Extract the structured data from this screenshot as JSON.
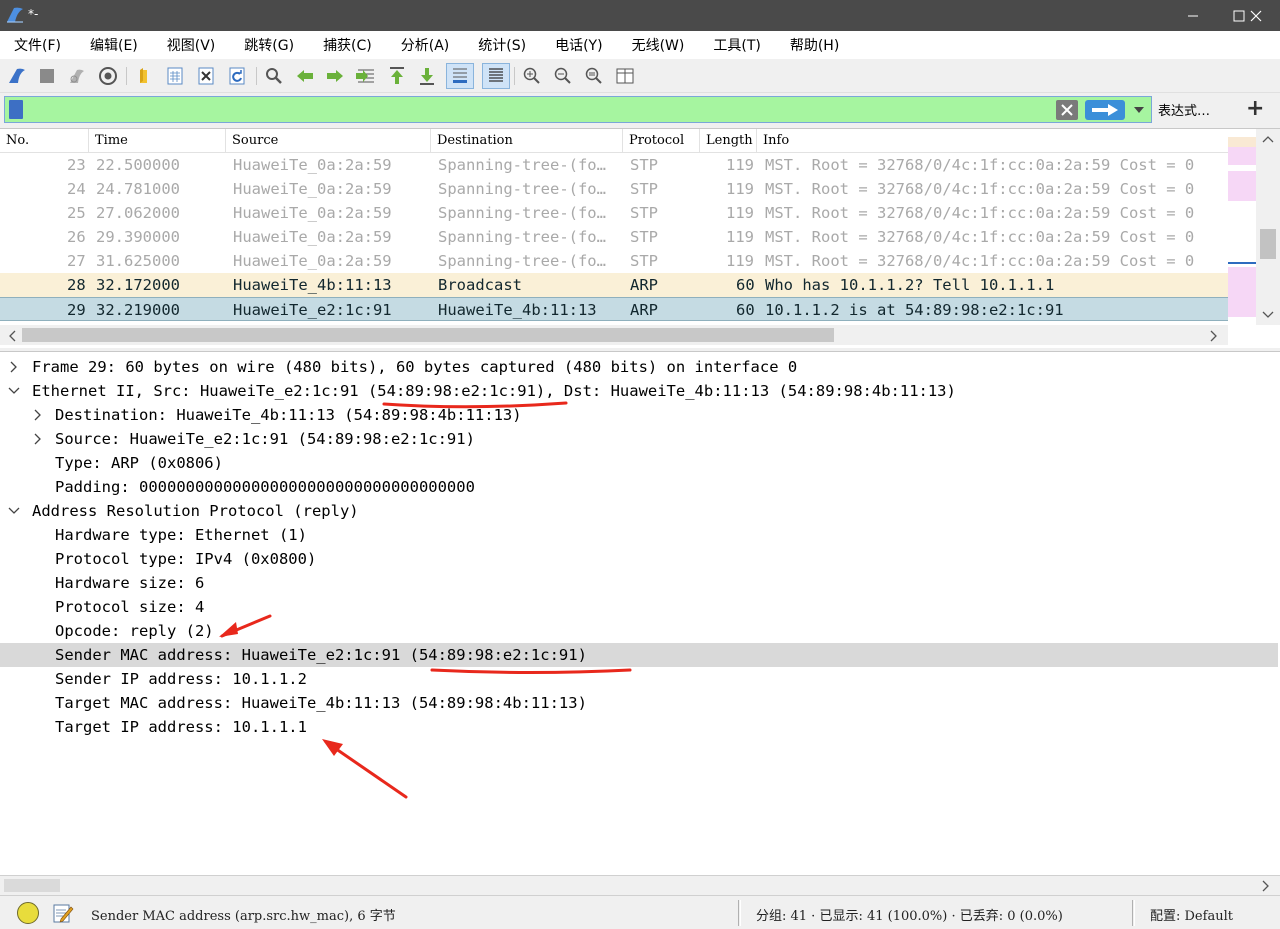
{
  "window": {
    "title": "*-",
    "minimize_icon": "minimize-icon",
    "maximize_icon": "maximize-icon",
    "close_icon": "close-icon"
  },
  "menu": [
    {
      "label": "文件(F)"
    },
    {
      "label": "编辑(E)"
    },
    {
      "label": "视图(V)"
    },
    {
      "label": "跳转(G)"
    },
    {
      "label": "捕获(C)"
    },
    {
      "label": "分析(A)"
    },
    {
      "label": "统计(S)"
    },
    {
      "label": "电话(Y)"
    },
    {
      "label": "无线(W)"
    },
    {
      "label": "工具(T)"
    },
    {
      "label": "帮助(H)"
    }
  ],
  "filter": {
    "value": "",
    "placeholder": "",
    "expression_button": "表达式…",
    "add_button": "+"
  },
  "packet_list": {
    "columns": [
      "No.",
      "Time",
      "Source",
      "Destination",
      "Protocol",
      "Length",
      "Info"
    ],
    "rows": [
      {
        "no": "23",
        "time": "22.500000",
        "source": "HuaweiTe_0a:2a:59",
        "destination": "Spanning-tree-(fo…",
        "protocol": "STP",
        "length": "119",
        "info": "MST. Root = 32768/0/4c:1f:cc:0a:2a:59  Cost = 0",
        "kind": "stp"
      },
      {
        "no": "24",
        "time": "24.781000",
        "source": "HuaweiTe_0a:2a:59",
        "destination": "Spanning-tree-(fo…",
        "protocol": "STP",
        "length": "119",
        "info": "MST. Root = 32768/0/4c:1f:cc:0a:2a:59  Cost = 0",
        "kind": "stp"
      },
      {
        "no": "25",
        "time": "27.062000",
        "source": "HuaweiTe_0a:2a:59",
        "destination": "Spanning-tree-(fo…",
        "protocol": "STP",
        "length": "119",
        "info": "MST. Root = 32768/0/4c:1f:cc:0a:2a:59  Cost = 0",
        "kind": "stp"
      },
      {
        "no": "26",
        "time": "29.390000",
        "source": "HuaweiTe_0a:2a:59",
        "destination": "Spanning-tree-(fo…",
        "protocol": "STP",
        "length": "119",
        "info": "MST. Root = 32768/0/4c:1f:cc:0a:2a:59  Cost = 0",
        "kind": "stp"
      },
      {
        "no": "27",
        "time": "31.625000",
        "source": "HuaweiTe_0a:2a:59",
        "destination": "Spanning-tree-(fo…",
        "protocol": "STP",
        "length": "119",
        "info": "MST. Root = 32768/0/4c:1f:cc:0a:2a:59  Cost = 0",
        "kind": "stp"
      },
      {
        "no": "28",
        "time": "32.172000",
        "source": "HuaweiTe_4b:11:13",
        "destination": "Broadcast",
        "protocol": "ARP",
        "length": "60",
        "info": "Who has 10.1.1.2? Tell 10.1.1.1",
        "kind": "arp1"
      },
      {
        "no": "29",
        "time": "32.219000",
        "source": "HuaweiTe_e2:1c:91",
        "destination": "HuaweiTe_4b:11:13",
        "protocol": "ARP",
        "length": "60",
        "info": "10.1.1.2 is at 54:89:98:e2:1c:91",
        "kind": "arp2"
      }
    ]
  },
  "detail_tree": [
    {
      "text": "Frame 29: 60 bytes on wire (480 bits), 60 bytes captured (480 bits) on interface 0",
      "level": 0,
      "arrow": "collapsed"
    },
    {
      "text": "Ethernet II, Src: HuaweiTe_e2:1c:91 (54:89:98:e2:1c:91), Dst: HuaweiTe_4b:11:13 (54:89:98:4b:11:13)",
      "level": 0,
      "arrow": "expanded"
    },
    {
      "text": "Destination: HuaweiTe_4b:11:13 (54:89:98:4b:11:13)",
      "level": 1,
      "arrow": "collapsed"
    },
    {
      "text": "Source: HuaweiTe_e2:1c:91 (54:89:98:e2:1c:91)",
      "level": 1,
      "arrow": "collapsed"
    },
    {
      "text": "Type: ARP (0x0806)",
      "level": 1,
      "arrow": "none"
    },
    {
      "text": "Padding: 000000000000000000000000000000000000",
      "level": 1,
      "arrow": "none"
    },
    {
      "text": "Address Resolution Protocol (reply)",
      "level": 0,
      "arrow": "expanded"
    },
    {
      "text": "Hardware type: Ethernet (1)",
      "level": 1,
      "arrow": "none"
    },
    {
      "text": "Protocol type: IPv4 (0x0800)",
      "level": 1,
      "arrow": "none"
    },
    {
      "text": "Hardware size: 6",
      "level": 1,
      "arrow": "none"
    },
    {
      "text": "Protocol size: 4",
      "level": 1,
      "arrow": "none"
    },
    {
      "text": "Opcode: reply (2)",
      "level": 1,
      "arrow": "none"
    },
    {
      "text": "Sender MAC address: HuaweiTe_e2:1c:91 (54:89:98:e2:1c:91)",
      "level": 1,
      "arrow": "none",
      "selected": true
    },
    {
      "text": "Sender IP address: 10.1.1.2",
      "level": 1,
      "arrow": "none"
    },
    {
      "text": "Target MAC address: HuaweiTe_4b:11:13 (54:89:98:4b:11:13)",
      "level": 1,
      "arrow": "none"
    },
    {
      "text": "Target IP address: 10.1.1.1",
      "level": 1,
      "arrow": "none"
    }
  ],
  "status": {
    "field_info": "Sender MAC address (arp.src.hw_mac), 6 字节",
    "packets": "分组: 41 · 已显示: 41 (100.0%) · 已丢弃: 0 (0.0%)",
    "profile": "配置: Default"
  },
  "colors": {
    "filter_bg": "#a6f5a0",
    "arp_request_bg": "#faf0d7",
    "arp_reply_bg": "#c5dbe3",
    "stp_text": "#a9a9a9",
    "annotation": "#e8281c"
  }
}
